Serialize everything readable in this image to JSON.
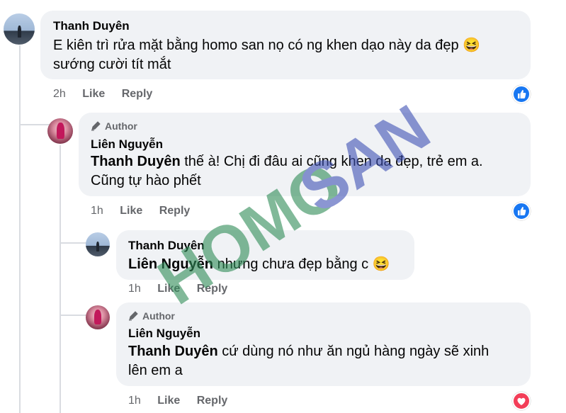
{
  "comments": [
    {
      "author": "Thanh Duyên",
      "is_author": false,
      "text_line1": "E kiên trì rửa mặt bằng homo san nọ có ng khen dạo này da đẹp",
      "emoji": "😆",
      "text_line2": "sướng cười tít mắt",
      "time": "2h",
      "like": "Like",
      "reply": "Reply",
      "reaction": "like"
    },
    {
      "author_badge": "Author",
      "author": "Liên Nguyễn",
      "is_author": true,
      "mention": "Thanh Duyên",
      "text_line1": " thế à! Chị đi đâu ai cũng khen da đẹp, trẻ em a.",
      "text_line2": "Cũng tự hào phết",
      "time": "1h",
      "like": "Like",
      "reply": "Reply",
      "reaction": "like"
    },
    {
      "author": "Thanh Duyên",
      "is_author": false,
      "mention": "Liên Nguyễn",
      "text_line1": " nhưng chưa đẹp bằng c",
      "emoji": "😆",
      "time": "1h",
      "like": "Like",
      "reply": "Reply"
    },
    {
      "author_badge": "Author",
      "author": "Liên Nguyễn",
      "is_author": true,
      "mention": "Thanh Duyên",
      "text_line1": " cứ dùng nó như ăn ngủ hàng ngày sẽ xinh",
      "text_line2": "lên em a",
      "time": "1h",
      "like": "Like",
      "reply": "Reply",
      "reaction": "love"
    }
  ],
  "watermark": {
    "part1": "HOMO",
    "part2": "SAN",
    "color1": "#2e8b57",
    "color2": "#3f51b5"
  },
  "colors": {
    "bubble": "#f0f2f5",
    "meta_text": "#65676b",
    "like_blue": "#1877f2",
    "love_red": "#f33e58"
  }
}
